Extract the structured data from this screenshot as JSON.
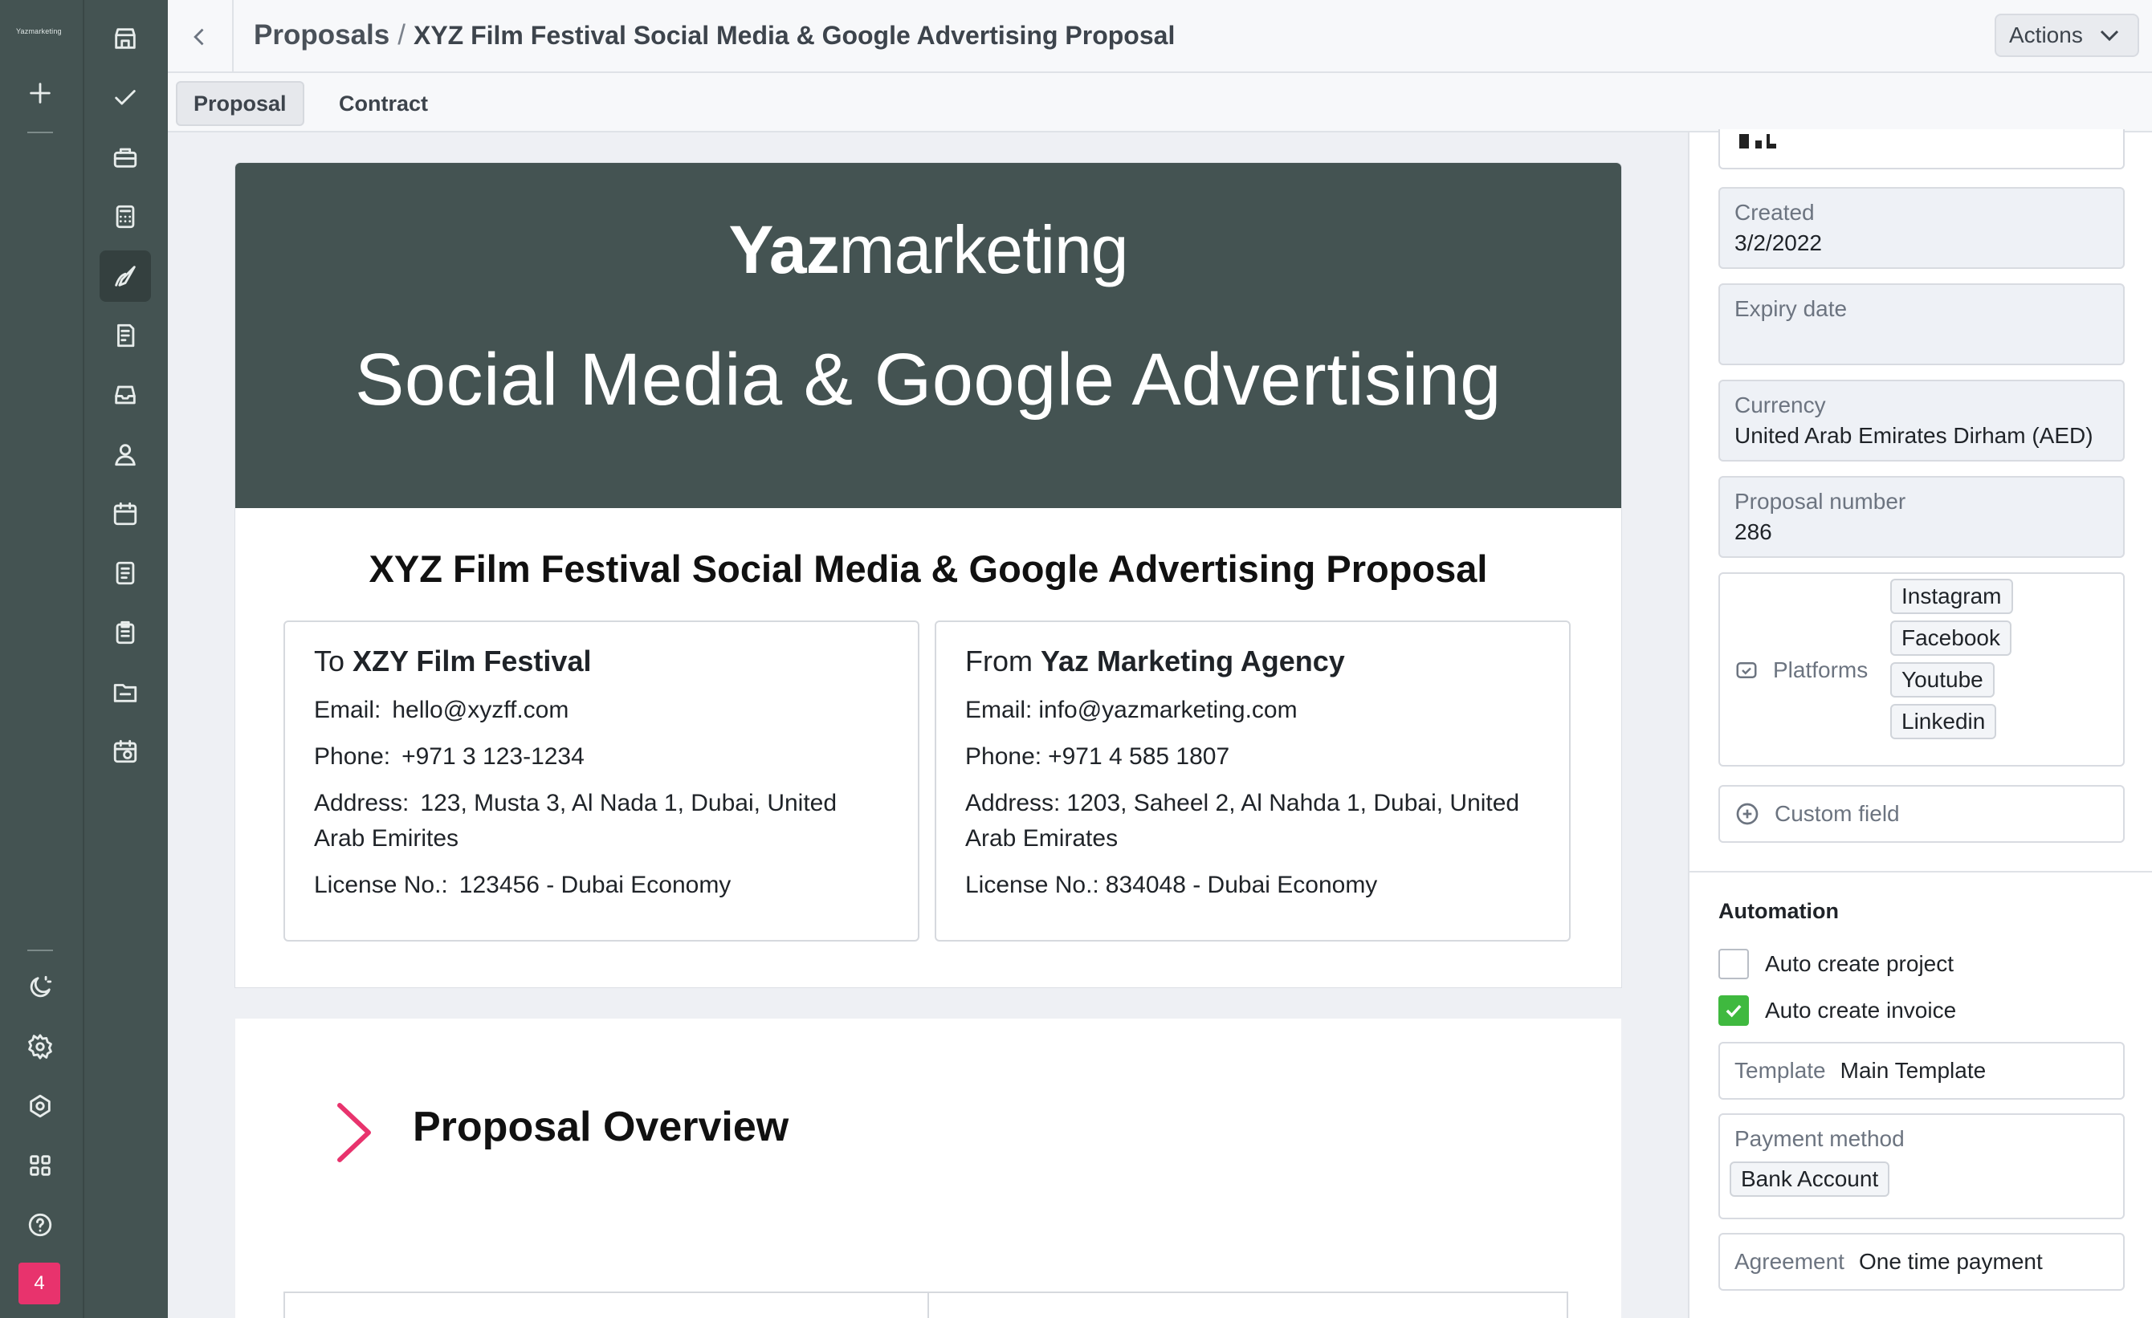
{
  "app": {
    "logo_text": "Yazmarketing",
    "notification_count": "4"
  },
  "header": {
    "crumb_root": "Proposals",
    "crumb_sep": "/",
    "crumb_current": "XYZ Film Festival Social Media & Google Advertising Proposal",
    "actions_label": "Actions"
  },
  "tabs": [
    {
      "label": "Proposal"
    },
    {
      "label": "Contract"
    }
  ],
  "document": {
    "brand_bold": "Yaz",
    "brand_light": "marketing",
    "hero_title": "Social Media & Google Advertising",
    "title": "XYZ Film Festival Social Media & Google Advertising Proposal",
    "to": {
      "prefix": "To",
      "name": "XZY Film Festival",
      "email_label": "Email:",
      "email": "hello@xyzff.com",
      "phone_label": "Phone:",
      "phone": "+971 3 123-1234",
      "address_label": "Address:",
      "address": "123, Musta 3, Al Nada 1, Dubai, United Arab Emirites",
      "license_label": "License No.:",
      "license": "123456 - Dubai Economy"
    },
    "from": {
      "prefix": "From",
      "name": "Yaz Marketing Agency",
      "email_label": "Email:",
      "email": "info@yazmarketing.com",
      "phone_label": "Phone:",
      "phone": "+971 4 585 1807",
      "address_label": "Address:",
      "address": "1203, Saheel 2, Al Nahda 1, Dubai, United Arab Emirates",
      "license_label": "License No.:",
      "license": "834048 - Dubai Economy"
    },
    "overview_title": "Proposal Overview"
  },
  "panel": {
    "created": {
      "label": "Created",
      "value": "3/2/2022"
    },
    "expiry": {
      "label": "Expiry date",
      "value": ""
    },
    "currency": {
      "label": "Currency",
      "value": "United Arab Emirates Dirham (AED)"
    },
    "number": {
      "label": "Proposal number",
      "value": "286"
    },
    "platforms": {
      "label": "Platforms",
      "items": [
        "Instagram",
        "Facebook",
        "Youtube",
        "Linkedin"
      ]
    },
    "custom_field": "Custom field",
    "automation_title": "Automation",
    "auto_project": {
      "label": "Auto create project",
      "checked": false
    },
    "auto_invoice": {
      "label": "Auto create invoice",
      "checked": true
    },
    "template": {
      "label": "Template",
      "value": "Main Template"
    },
    "payment": {
      "label": "Payment method",
      "value": "Bank Account"
    },
    "agreement": {
      "label": "Agreement",
      "value": "One time payment"
    }
  },
  "colors": {
    "rail": "#445352",
    "accent": "#e8336d",
    "check": "#3fb93f"
  }
}
